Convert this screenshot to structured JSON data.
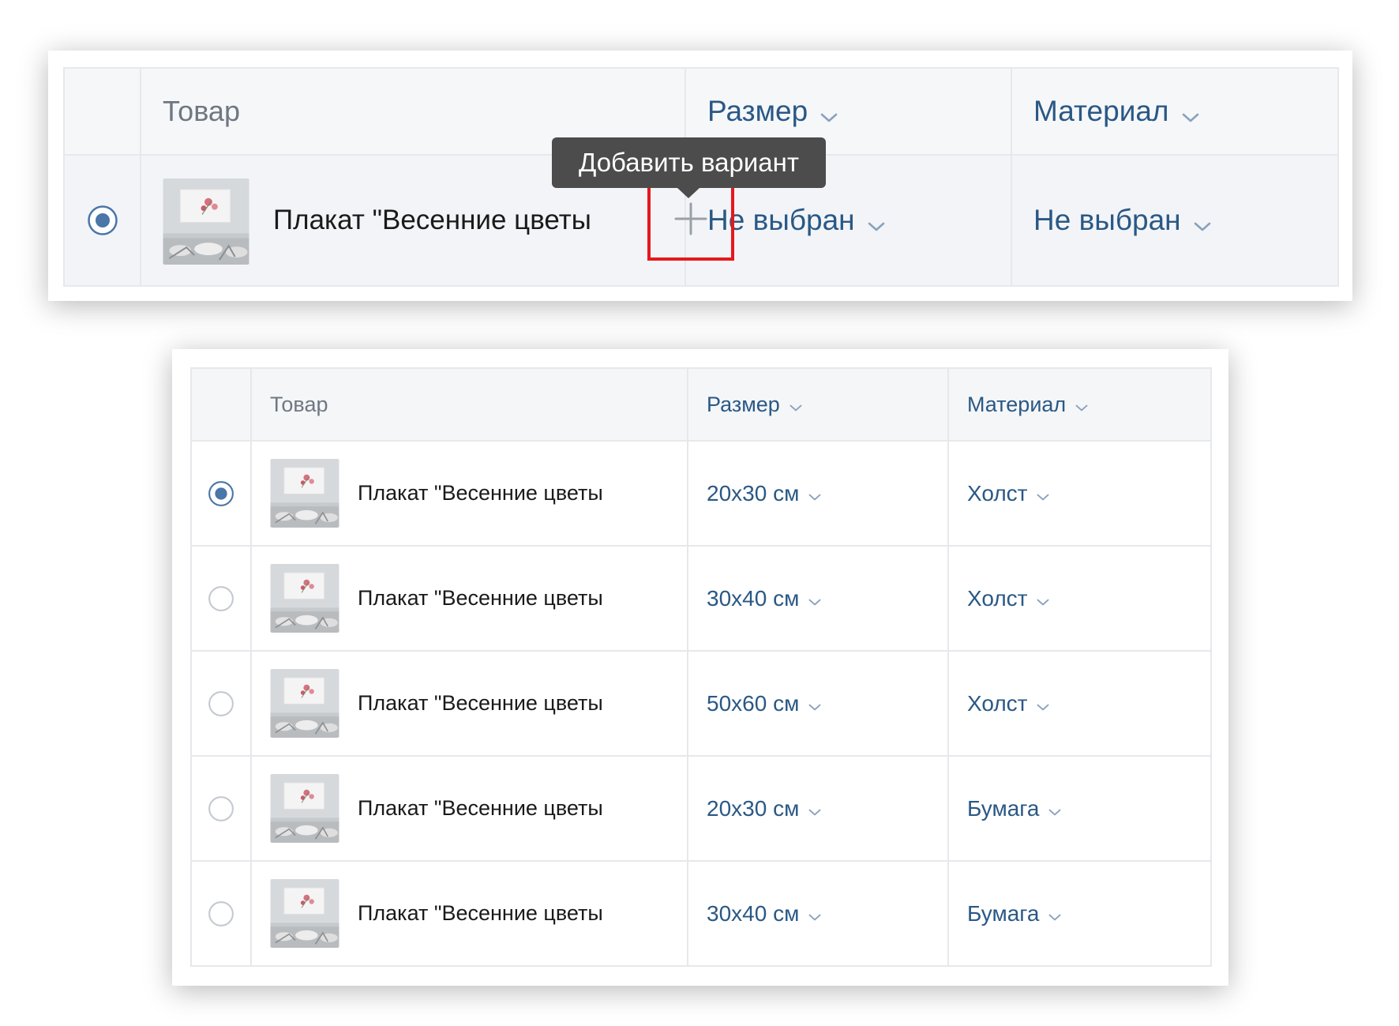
{
  "colors": {
    "link": "#2a5885",
    "header_text": "#6f7782",
    "row_text": "#1a1a1a",
    "highlight": "#e5181d",
    "tooltip_bg": "#4c4c4c",
    "radio_checked": "#4a76a8"
  },
  "top_table": {
    "headers": {
      "product": "Товар",
      "size": "Размер",
      "material": "Материал"
    },
    "row": {
      "selected": true,
      "product_name": "Плакат \"Весенние цветы",
      "size": "Не выбран",
      "material": "Не выбран"
    },
    "add_button": {
      "icon": "plus-icon",
      "tooltip": "Добавить вариант"
    }
  },
  "bottom_table": {
    "headers": {
      "product": "Товар",
      "size": "Размер",
      "material": "Материал"
    },
    "rows": [
      {
        "selected": true,
        "product_name": "Плакат \"Весенние цветы",
        "size": "20x30 см",
        "material": "Холст"
      },
      {
        "selected": false,
        "product_name": "Плакат \"Весенние цветы",
        "size": "30x40 см",
        "material": "Холст"
      },
      {
        "selected": false,
        "product_name": "Плакат \"Весенние цветы",
        "size": "50x60 см",
        "material": "Холст"
      },
      {
        "selected": false,
        "product_name": "Плакат \"Весенние цветы",
        "size": "20x30 см",
        "material": "Бумага"
      },
      {
        "selected": false,
        "product_name": "Плакат \"Весенние цветы",
        "size": "30x40 см",
        "material": "Бумага"
      }
    ]
  }
}
